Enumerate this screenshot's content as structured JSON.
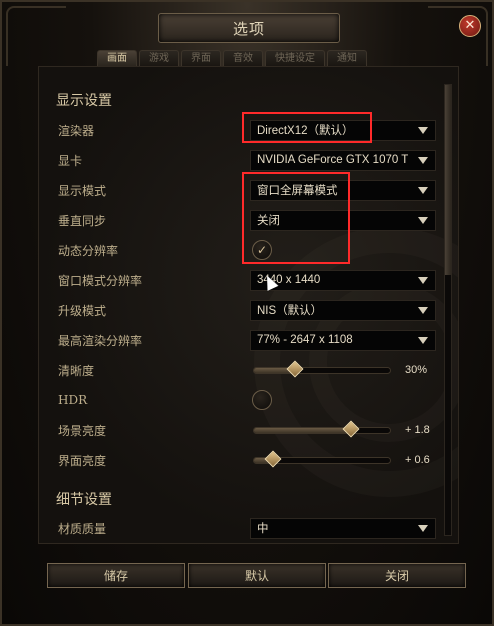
{
  "window": {
    "title": "选项",
    "close_icon": "✕"
  },
  "tabs": [
    {
      "label": "画面",
      "active": true
    },
    {
      "label": "游戏",
      "active": false
    },
    {
      "label": "界面",
      "active": false
    },
    {
      "label": "音效",
      "active": false
    },
    {
      "label": "快捷设定",
      "active": false
    },
    {
      "label": "通知",
      "active": false
    }
  ],
  "sections": {
    "display": "显示设置",
    "detail": "细节设置"
  },
  "settings": {
    "renderer": {
      "label": "渲染器",
      "value": "DirectX12（默认）"
    },
    "gpu": {
      "label": "显卡",
      "value": "NVIDIA GeForce GTX 1070 T"
    },
    "display_mode": {
      "label": "显示模式",
      "value": "窗口全屏幕模式"
    },
    "vsync": {
      "label": "垂直同步",
      "value": "关闭"
    },
    "dynamic_resolution": {
      "label": "动态分辨率",
      "checked": true,
      "check_glyph": "✓"
    },
    "window_resolution": {
      "label": "窗口模式分辨率",
      "value": "3440 x 1440"
    },
    "upscale_mode": {
      "label": "升级模式",
      "value": "NIS（默认）"
    },
    "max_render_resolution": {
      "label": "最高渲染分辨率",
      "value": "77% - 2647 x 1108"
    },
    "sharpness": {
      "label": "清晰度",
      "value_text": "30%",
      "level": 0.3
    },
    "hdr": {
      "label": "HDR",
      "checked": false
    },
    "scene_brightness": {
      "label": "场景亮度",
      "value_text": "+ 1.8",
      "level": 0.71
    },
    "ui_brightness": {
      "label": "界面亮度",
      "value_text": "+ 0.6",
      "level": 0.14
    },
    "material_quality": {
      "label": "材质质量",
      "value": "中"
    }
  },
  "footer": {
    "save": "储存",
    "default": "默认",
    "close": "关闭"
  },
  "colors": {
    "highlight": "#ff2a2a",
    "text": "#cfc3a6",
    "accent_gold": "#e2c48c"
  }
}
